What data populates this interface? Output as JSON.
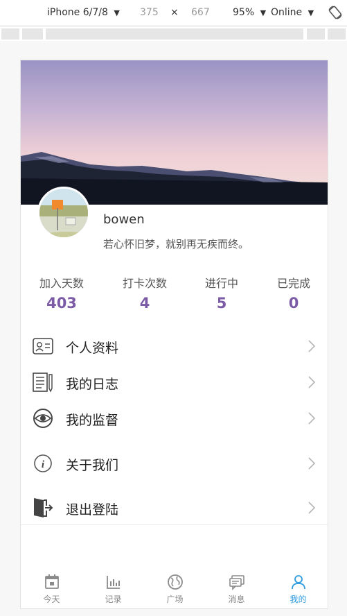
{
  "devtools": {
    "device": "iPhone 6/7/8",
    "width": "375",
    "times": "×",
    "height": "667",
    "zoom": "95%",
    "network": "Online",
    "caret": "▼"
  },
  "profile": {
    "username": "bowen",
    "motto": "若心怀旧梦，就别再无疾而终。"
  },
  "stats": [
    {
      "label": "加入天数",
      "value": "403"
    },
    {
      "label": "打卡次数",
      "value": "4"
    },
    {
      "label": "进行中",
      "value": "5"
    },
    {
      "label": "已完成",
      "value": "0"
    }
  ],
  "menu": [
    {
      "label": "个人资料",
      "icon": "id-card-icon"
    },
    {
      "label": "我的日志",
      "icon": "journal-icon"
    },
    {
      "label": "我的监督",
      "icon": "eye-icon"
    },
    {
      "label": "关于我们",
      "icon": "info-icon"
    },
    {
      "label": "退出登陆",
      "icon": "exit-door-icon"
    }
  ],
  "tabs": [
    {
      "label": "今天",
      "icon": "calendar-icon"
    },
    {
      "label": "记录",
      "icon": "bar-chart-icon"
    },
    {
      "label": "广场",
      "icon": "globe-icon"
    },
    {
      "label": "消息",
      "icon": "message-icon"
    },
    {
      "label": "我的",
      "icon": "user-icon",
      "active": true
    }
  ],
  "colors": {
    "stat_number": "#7b5aa6",
    "active_tab": "#2f9be0"
  }
}
